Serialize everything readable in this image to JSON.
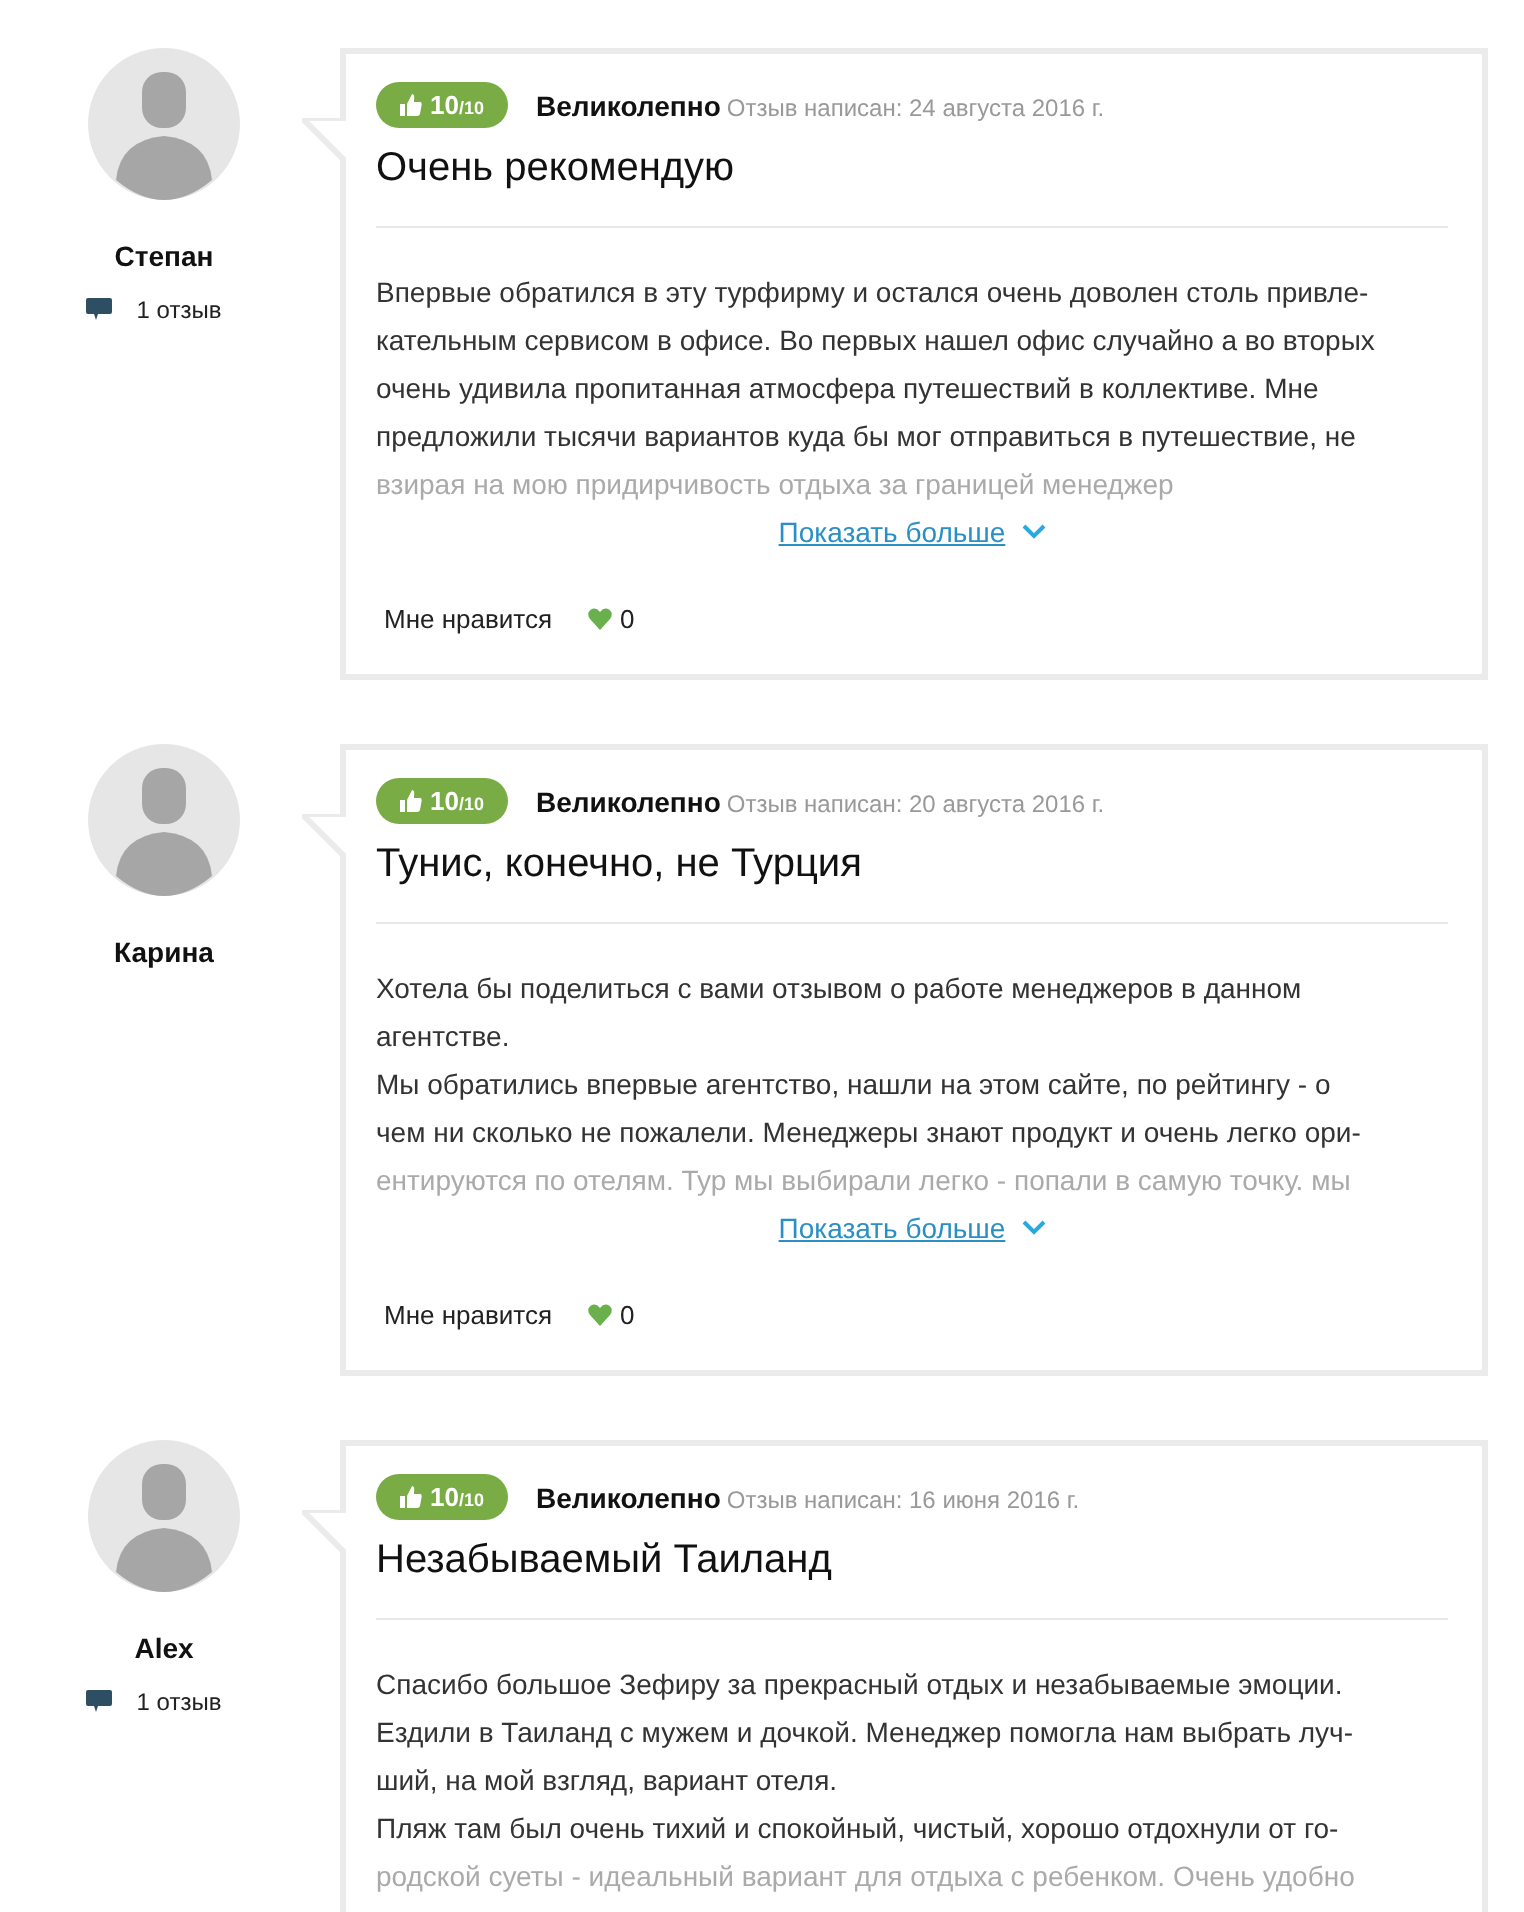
{
  "reviews": [
    {
      "author": "Степан",
      "review_count": "1 отзыв",
      "score": "10$_{/10}$",
      "verdict": "Великолепно",
      "date": "Отзыв написан: 24 августа 2016 г.",
      "title": "Очень рекомендую",
      "lines": [
        "Впервые обратился в эту турфирму и остался очень доволен столь привле-",
        "кательным сервисом в офисе. Во первых нашел офис случайно а во вторых",
        "очень удивила пропитанная атмосфера путешествий в коллективе. Мне",
        "предложили тысячи вариантов куда бы мог отправиться в путешествие, не",
        "взирая на мою придирчивость отдыха за границей менеджер"
      ],
      "more": "Показать больше",
      "like_label": "Мне нравится",
      "likes": "0"
    },
    {
      "author": "Карина",
      "score": "10$_{/10}$",
      "verdict": "Великолепно",
      "date": "Отзыв написан: 20 августа 2016 г.",
      "title": "Тунис, конечно, не Турция",
      "lines": [
        "Хотела бы поделиться с вами отзывом о работе менеджеров в данном",
        "агентстве.",
        "Мы обратились впервые агентство, нашли на этом сайте, по рейтингу - о",
        "чем ни сколько не пожалели. Менеджеры знают продукт и очень легко ори-",
        "ентируются по отелям. Тур мы выбирали легко - попали в самую точку. мы"
      ],
      "more": "Показать больше",
      "like_label": "Мне нравится",
      "likes": "0"
    },
    {
      "author": "Alex",
      "review_count": "1 отзыв",
      "score": "10$_{/10}$",
      "verdict": "Великолепно",
      "date": "Отзыв написан: 16 июня 2016 г.",
      "title": "Незабываемый Таиланд",
      "lines": [
        "Спасибо большое Зефиру за прекрасный отдых и незабываемые эмоции.",
        "Ездили в Таиланд с мужем и дочкой. Менеджер помогла нам выбрать луч-",
        "ший, на мой взгляд, вариант отеля.",
        "Пляж там был очень тихий и спокойный, чистый, хорошо отдохнули от го-",
        "родской суеты - идеальный вариант для отдыха с ребенком. Очень удобно"
      ]
    }
  ]
}
